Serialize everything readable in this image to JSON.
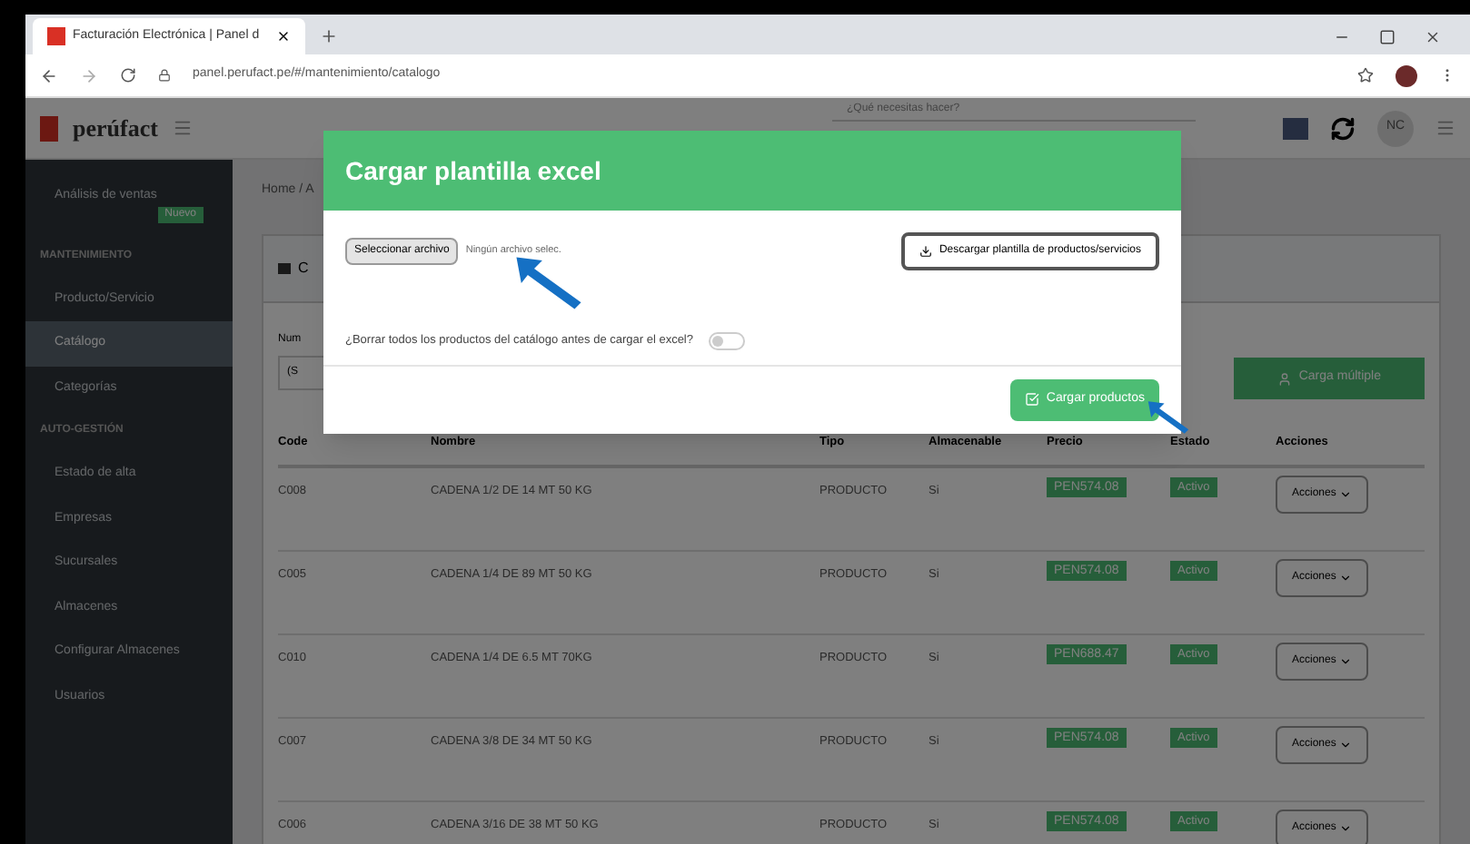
{
  "browser": {
    "tab_title": "Facturación Electrónica | Panel d",
    "url": "panel.perufact.pe/#/mantenimiento/catalogo"
  },
  "header": {
    "logo": "perúfact",
    "search_placeholder": "¿Qué necesitas hacer?",
    "avatar": "NC"
  },
  "sidebar": {
    "items": [
      {
        "kind": "item",
        "label": "Análisis de ventas",
        "badge": "Nuevo",
        "selected": false
      },
      {
        "kind": "section",
        "label": "MANTENIMIENTO"
      },
      {
        "kind": "item",
        "label": "Producto/Servicio",
        "selected": false
      },
      {
        "kind": "item",
        "label": "Catálogo",
        "selected": true
      },
      {
        "kind": "item",
        "label": "Categorías",
        "selected": false
      },
      {
        "kind": "section",
        "label": "AUTO-GESTIÓN"
      },
      {
        "kind": "item",
        "label": "Estado de alta",
        "selected": false
      },
      {
        "kind": "item",
        "label": "Empresas",
        "selected": false
      },
      {
        "kind": "item",
        "label": "Sucursales",
        "selected": false
      },
      {
        "kind": "item",
        "label": "Almacenes",
        "selected": false
      },
      {
        "kind": "item",
        "label": "Configurar Almacenes",
        "selected": false
      },
      {
        "kind": "item",
        "label": "Usuarios",
        "selected": false
      }
    ]
  },
  "breadcrumb": "Home / A",
  "card_title": "C",
  "filter_label": "Num",
  "filter_value": "(S",
  "bulk_button": "Carga múltiple",
  "table": {
    "columns": [
      "Code",
      "Nombre",
      "Tipo",
      "Almacenable",
      "Precio",
      "Estado",
      "Acciones"
    ],
    "rows": [
      {
        "code": "C008",
        "name": "CADENA 1/2 DE 14 MT 50 KG",
        "type": "PRODUCTO",
        "storable": "Si",
        "price": "PEN574.08",
        "status": "Activo",
        "action": "Acciones"
      },
      {
        "code": "C005",
        "name": "CADENA 1/4 DE 89 MT 50 KG",
        "type": "PRODUCTO",
        "storable": "Si",
        "price": "PEN574.08",
        "status": "Activo",
        "action": "Acciones"
      },
      {
        "code": "C010",
        "name": "CADENA 1/4 DE 6.5 MT 70KG",
        "type": "PRODUCTO",
        "storable": "Si",
        "price": "PEN688.47",
        "status": "Activo",
        "action": "Acciones"
      },
      {
        "code": "C007",
        "name": "CADENA 3/8 DE 34 MT 50 KG",
        "type": "PRODUCTO",
        "storable": "Si",
        "price": "PEN574.08",
        "status": "Activo",
        "action": "Acciones"
      },
      {
        "code": "C006",
        "name": "CADENA 3/16 DE 38 MT 50 KG",
        "type": "PRODUCTO",
        "storable": "Si",
        "price": "PEN574.08",
        "status": "Activo",
        "action": "Acciones"
      }
    ]
  },
  "modal": {
    "title": "Cargar plantilla excel",
    "file_button": "Seleccionar archivo",
    "file_status": "Ningún archivo selec.",
    "download_button": "Descargar plantilla de productos/servicios",
    "delete_question": "¿Borrar todos los productos del catálogo antes de cargar el excel?",
    "delete_switch_on": false,
    "submit_button": "Cargar productos"
  }
}
